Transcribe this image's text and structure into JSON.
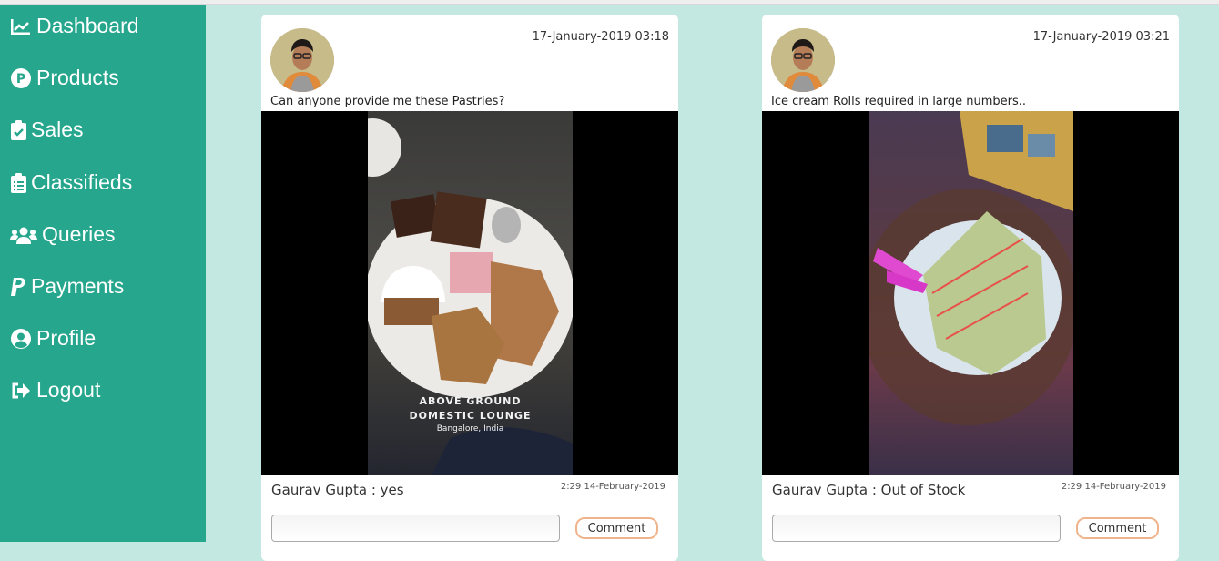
{
  "sidebar": {
    "items": [
      {
        "label": "Dashboard",
        "icon": "chart-line-icon"
      },
      {
        "label": "Products",
        "icon": "product-p-circle-icon"
      },
      {
        "label": "Sales",
        "icon": "clipboard-check-icon"
      },
      {
        "label": "Classifieds",
        "icon": "clipboard-list-icon"
      },
      {
        "label": "Queries",
        "icon": "users-icon"
      },
      {
        "label": "Payments",
        "icon": "paypal-icon"
      },
      {
        "label": "Profile",
        "icon": "user-circle-icon"
      },
      {
        "label": "Logout",
        "icon": "sign-out-icon"
      }
    ]
  },
  "posts": [
    {
      "timestamp": "17-January-2019 03:18",
      "text": "Can anyone provide me these Pastries?",
      "photo_overlay": {
        "line1": "ABOVE GROUND",
        "line2": "DOMESTIC LOUNGE",
        "line3": "Bangalore, India"
      },
      "comment": "Gaurav Gupta : yes",
      "comment_time": "2:29 14-February-2019",
      "comment_input_value": "",
      "comment_button": "Comment"
    },
    {
      "timestamp": "17-January-2019 03:21",
      "text": "Ice cream Rolls required in large numbers..",
      "comment": "Gaurav Gupta : Out of Stock",
      "comment_time": "2:29 14-February-2019",
      "comment_input_value": "",
      "comment_button": "Comment"
    }
  ],
  "colors": {
    "sidebar": "#26a68c",
    "background": "#c3e8e1",
    "comment_button_border": "#f0b48c"
  }
}
